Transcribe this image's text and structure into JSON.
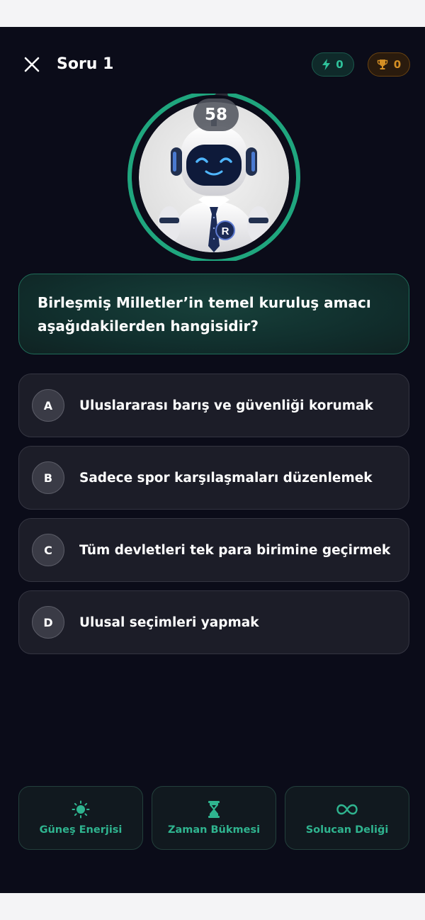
{
  "header": {
    "title": "Soru 1",
    "energy_count": "0",
    "trophy_count": "0"
  },
  "timer": {
    "seconds_left": "58",
    "progress_fraction": 0.97,
    "ring_color": "#1fa67e"
  },
  "mascot": {
    "badge_letter": "R"
  },
  "question": {
    "text": "Birleşmiş Milletler’in temel kuruluş amacı aşağıdakilerden hangisidir?"
  },
  "options": [
    {
      "letter": "A",
      "text": "Uluslararası barış ve güvenliği korumak"
    },
    {
      "letter": "B",
      "text": "Sadece spor karşılaşmaları düzenlemek"
    },
    {
      "letter": "C",
      "text": "Tüm devletleri tek para birimine geçirmek"
    },
    {
      "letter": "D",
      "text": "Ulusal seçimleri yapmak"
    }
  ],
  "powerups": [
    {
      "label": "Güneş Enerjisi",
      "icon": "sun-icon"
    },
    {
      "label": "Zaman Bükmesi",
      "icon": "hourglass-icon"
    },
    {
      "label": "Solucan Deliği",
      "icon": "infinity-icon"
    }
  ],
  "colors": {
    "accent_green": "#2fc29b",
    "accent_orange": "#d48f24",
    "background": "#0b0c19"
  }
}
